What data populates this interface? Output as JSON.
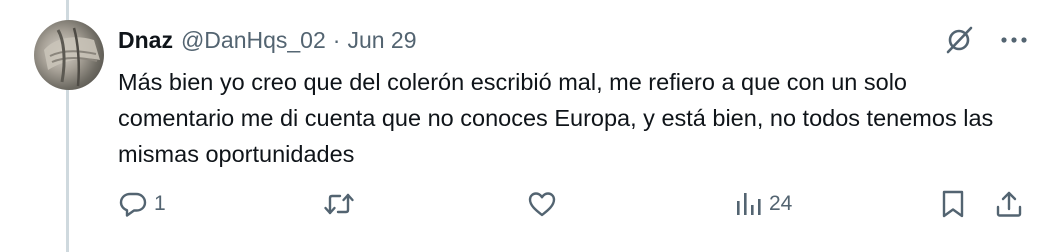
{
  "tweet": {
    "author_name": "Dnaz",
    "handle": "@DanHqs_02",
    "separator": "·",
    "date": "Jun 29",
    "text": "Más bien yo creo que del colerón escribió mal, me refiero a que con un solo comentario me di cuenta que no conoces Europa, y está bien, no todos tenemos las mismas oportunidades"
  },
  "actions": {
    "reply_count": "1",
    "retweet_count": "",
    "like_count": "",
    "views_count": "24"
  },
  "icons": {
    "grok": "grok-icon",
    "more": "more-icon",
    "reply": "reply-icon",
    "retweet": "retweet-icon",
    "like": "heart-icon",
    "views": "views-icon",
    "bookmark": "bookmark-icon",
    "share": "share-icon"
  },
  "colors": {
    "text": "#0f1419",
    "secondary": "#536471",
    "thread_line": "#cfd9de"
  }
}
